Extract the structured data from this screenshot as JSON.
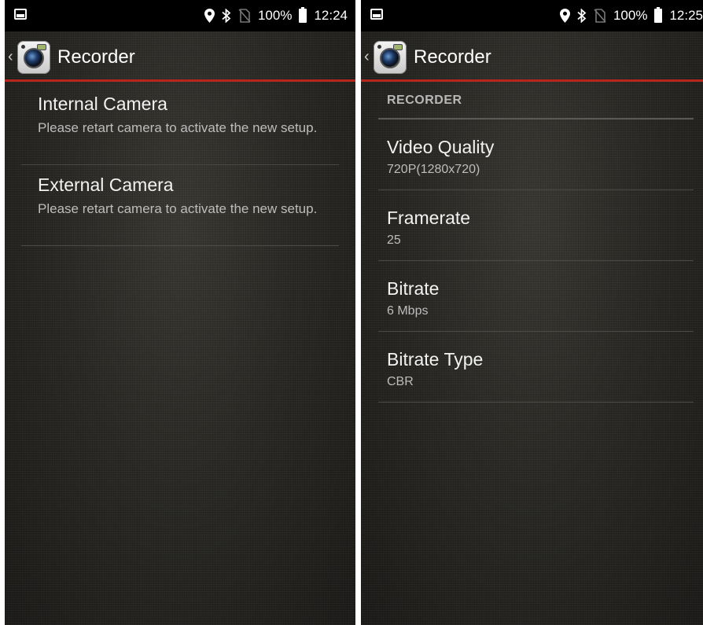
{
  "left": {
    "status": {
      "battery": "100%",
      "time": "12:24"
    },
    "app_title": "Recorder",
    "items": [
      {
        "title": "Internal Camera",
        "summary": "Please retart camera to activate the new setup."
      },
      {
        "title": "External Camera",
        "summary": "Please retart camera to activate the new setup."
      }
    ]
  },
  "right": {
    "status": {
      "battery": "100%",
      "time": "12:25"
    },
    "app_title": "Recorder",
    "category": "RECORDER",
    "items": [
      {
        "title": "Video Quality",
        "summary": "720P(1280x720)"
      },
      {
        "title": "Framerate",
        "summary": "25"
      },
      {
        "title": "Bitrate",
        "summary": "6 Mbps"
      },
      {
        "title": "Bitrate Type",
        "summary": "CBR"
      }
    ]
  },
  "icons": {
    "status_left": "photo-notification-icon",
    "status_right": [
      "location-pin-icon",
      "bluetooth-icon",
      "no-sim-icon",
      "battery-icon"
    ],
    "app": "camera-app-icon",
    "back": "chevron-left-icon"
  },
  "colors": {
    "accent": "#b5271d",
    "statusbar": "#000000",
    "background": "#262522"
  }
}
